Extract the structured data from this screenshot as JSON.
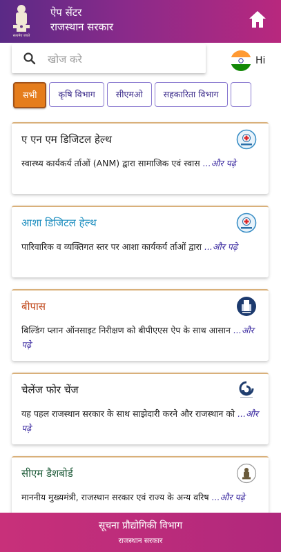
{
  "header": {
    "title_line1": "ऐप सेंटर",
    "title_line2": "राजस्थान सरकार",
    "emblem_text": "सत्यमेव जयते",
    "home_icon": "home-icon"
  },
  "search": {
    "placeholder": "खोज करे",
    "icon": "search-icon"
  },
  "language": {
    "label": "Hi",
    "flag": "india-flag-icon"
  },
  "filters": [
    {
      "label": "सभी",
      "active": true
    },
    {
      "label": "कृषि विभाग",
      "active": false
    },
    {
      "label": "सीएमओ",
      "active": false
    },
    {
      "label": "सहकारिता विभाग",
      "active": false
    }
  ],
  "apps": [
    {
      "title": "ए एन एम डिजिटल हेल्थ",
      "title_color": "#222222",
      "desc": "स्वास्थ्य कार्यकर्य र्ताओं (ANM) द्वारा सामाजिक एवं स्वास",
      "more": "...और पढ़े",
      "logo": "anm-logo-icon"
    },
    {
      "title": "आशा डिजिटल हेल्थ",
      "title_color": "#1f8fc0",
      "desc": "पारिवारिक व व्यक्तिगत स्तर पर आशा कार्यकर्य र्ताओं द्वारा",
      "more": "...और पढ़े",
      "logo": "asha-logo-icon"
    },
    {
      "title": "बीपास",
      "title_color": "#c0471a",
      "desc": "बिल्डिंग प्लान ऑनसाइट निरीक्षण को बीपीएएस ऐप के साथ आसान",
      "more": "...और पढ़े",
      "logo": "bpas-logo-icon"
    },
    {
      "title": "चेलेंज फोर चेंज",
      "title_color": "#222222",
      "desc": "यह पहल राजस्थान सरकार के साथ साझेदारी करने और राजस्थान को",
      "more": "...और पढ़े",
      "logo": "challenge-for-change-logo-icon"
    },
    {
      "title": "सीएम डैशबोर्ड",
      "title_color": "#1f5c3a",
      "desc": "माननीय मुख्यमंत्री, राजस्थान सरकार एवं राज्य के अन्य वरिष",
      "more": "...और पढ़े",
      "logo": "cm-dashboard-logo-icon"
    }
  ],
  "footer": {
    "line1": "सूचना प्रौद्योगिकी विभाग",
    "line2": "राजस्थान सरकार"
  }
}
